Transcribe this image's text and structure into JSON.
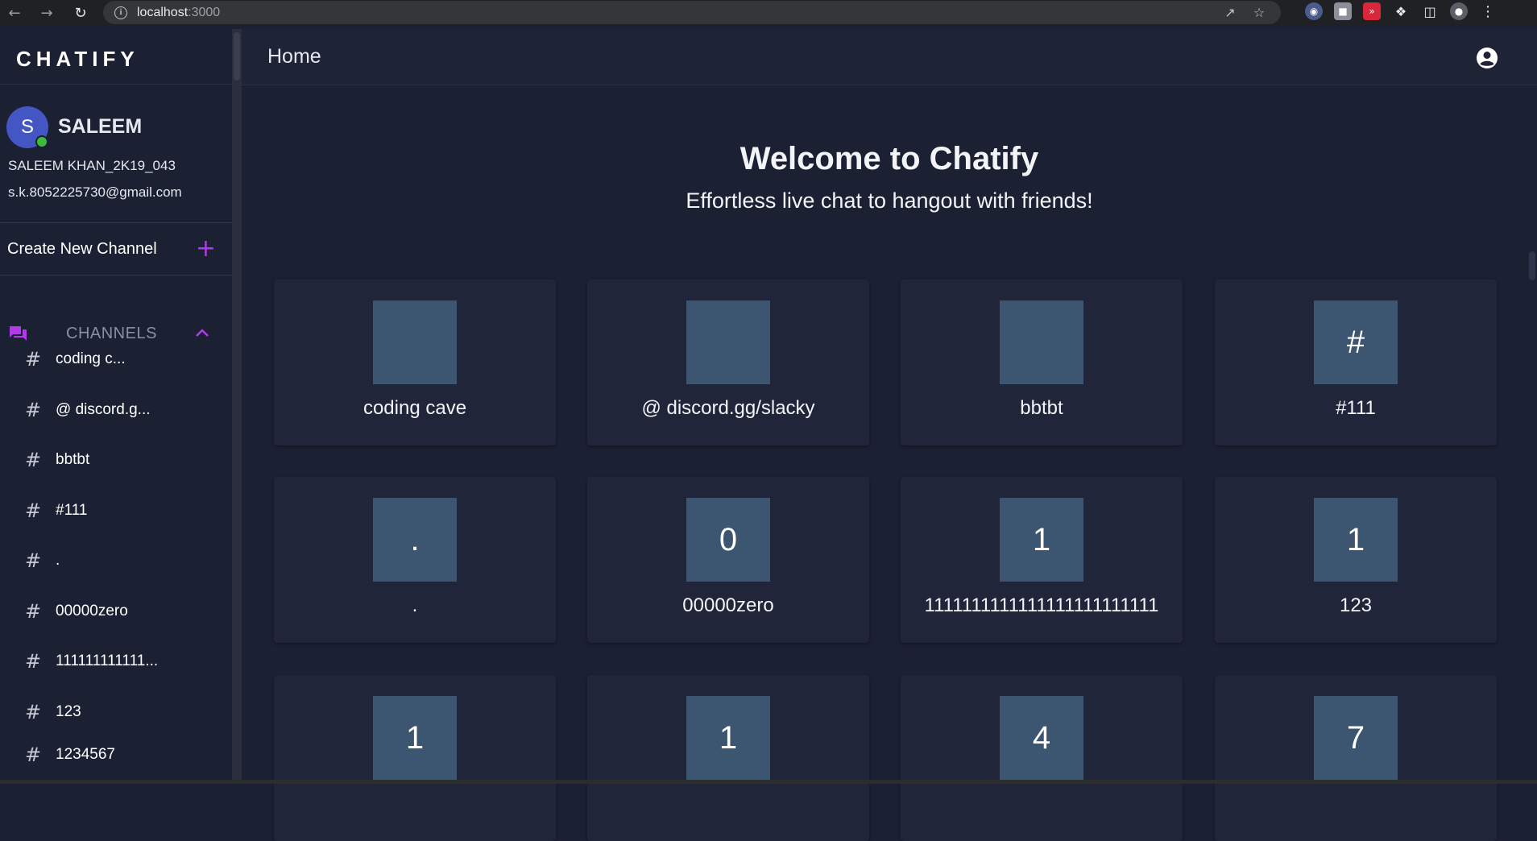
{
  "browser": {
    "url_host": "localhost",
    "url_port": ":3000"
  },
  "sidebar": {
    "brand": "CHATIFY",
    "user": {
      "avatar_letter": "S",
      "name": "SALEEM",
      "full_name": "SALEEM KHAN_2K19_043",
      "email": "s.k.8052225730@gmail.com"
    },
    "create_channel_label": "Create New Channel",
    "channels_label": "CHANNELS",
    "channels": [
      {
        "label": "coding c..."
      },
      {
        "label": "@ discord.g..."
      },
      {
        "label": "bbtbt"
      },
      {
        "label": "#111"
      },
      {
        "label": "."
      },
      {
        "label": "00000zero"
      },
      {
        "label": "111111111111..."
      },
      {
        "label": "123"
      },
      {
        "label": "1234567"
      }
    ]
  },
  "topbar": {
    "title": "Home"
  },
  "main": {
    "welcome_title": "Welcome to Chatify",
    "welcome_subtitle": "Effortless live chat to hangout with friends!",
    "cards": [
      {
        "initial": "",
        "name": "coding cave"
      },
      {
        "initial": "",
        "name": "@ discord.gg/slacky"
      },
      {
        "initial": "",
        "name": "bbtbt"
      },
      {
        "initial": "#",
        "name": "#111"
      },
      {
        "initial": ".",
        "name": "."
      },
      {
        "initial": "0",
        "name": "00000zero"
      },
      {
        "initial": "1",
        "name": "1111111111111111111111111"
      },
      {
        "initial": "1",
        "name": "123"
      },
      {
        "initial": "1",
        "name": ""
      },
      {
        "initial": "1",
        "name": ""
      },
      {
        "initial": "4",
        "name": ""
      },
      {
        "initial": "7",
        "name": ""
      }
    ]
  },
  "colors": {
    "accent": "#b13be8",
    "online": "#3dbb3a",
    "avatar": "#4356c4",
    "tile": "#3c5570"
  }
}
